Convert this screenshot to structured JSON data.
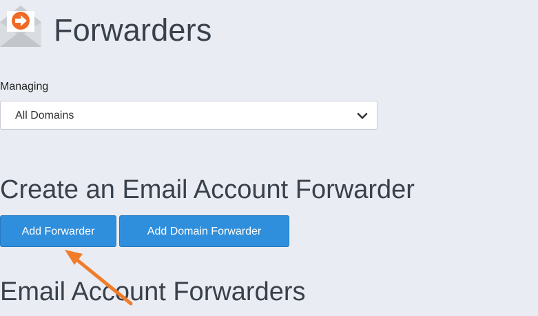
{
  "header": {
    "title": "Forwarders",
    "icon": "forwarder-envelope-icon"
  },
  "managing": {
    "label": "Managing",
    "selected": "All Domains"
  },
  "create_section": {
    "title": "Create an Email Account Forwarder",
    "add_forwarder_label": "Add Forwarder",
    "add_domain_forwarder_label": "Add Domain Forwarder"
  },
  "list_section": {
    "title": "Email Account Forwarders"
  },
  "colors": {
    "background": "#e9ecf2",
    "button_primary": "#2f8fdc",
    "annotation_arrow": "#f07c2a",
    "icon_orange": "#f06a24"
  }
}
